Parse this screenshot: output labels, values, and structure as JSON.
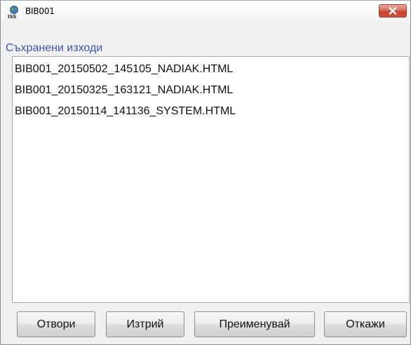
{
  "window": {
    "title": "BIB001",
    "app_icon": "iss-globe-icon",
    "close_icon": "close-icon"
  },
  "section_label": "Съхранени изходи",
  "files": [
    "BIB001_20150502_145105_NADIAK.HTML",
    "BIB001_20150325_163121_NADIAK.HTML",
    "BIB001_20150114_141136_SYSTEM.HTML"
  ],
  "buttons": {
    "open": "Отвори",
    "delete": "Изтрий",
    "rename": "Преименувай",
    "cancel": "Откажи"
  },
  "colors": {
    "label_text": "#3b56a8",
    "close_button": "#c8442f"
  }
}
